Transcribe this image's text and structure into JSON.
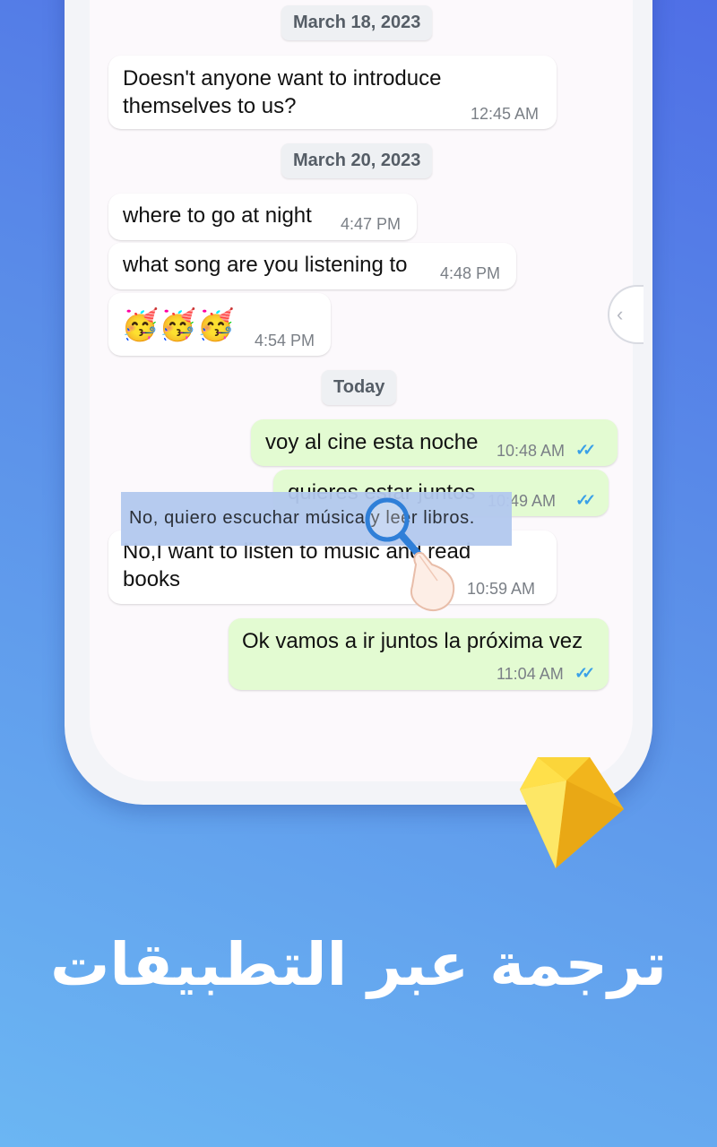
{
  "chat": {
    "date1": "March 18, 2023",
    "msg1": {
      "line1": "Doesn't anyone want to introduce",
      "line2": "themselves to us?",
      "time": "12:45 AM"
    },
    "date2": "March 20, 2023",
    "msg2": {
      "text": "where to go at night",
      "time": "4:47 PM"
    },
    "msg3": {
      "text": "what song are you listening to",
      "time": "4:48 PM"
    },
    "msg4": {
      "text": "🥳🥳🥳",
      "time": "4:54 PM"
    },
    "date3": "Today",
    "msg5": {
      "text": "voy al cine esta noche",
      "time": "10:48 AM",
      "status": "✓✓"
    },
    "msg6": {
      "text": "quieres estar juntos",
      "time": "10:49 AM",
      "status": "✓✓"
    },
    "msg7": {
      "line1": "No,I want to listen to music and read",
      "line2": "books",
      "time": "10:59 AM"
    },
    "msg8": {
      "text": "Ok vamos a ir juntos la próxima vez",
      "time": "11:04 AM",
      "status": "✓✓"
    }
  },
  "side_handle": {
    "icon": "chevron-left-icon",
    "glyph": "‹"
  },
  "translation_popup": {
    "text": "No, quiero escuchar música y leer libros."
  },
  "caption": "ترجمة عبر التطبيقات",
  "colors": {
    "accent": "#3b8de0",
    "outgoing_bubble": "#e3fbd2",
    "gem": "#f6c326"
  }
}
